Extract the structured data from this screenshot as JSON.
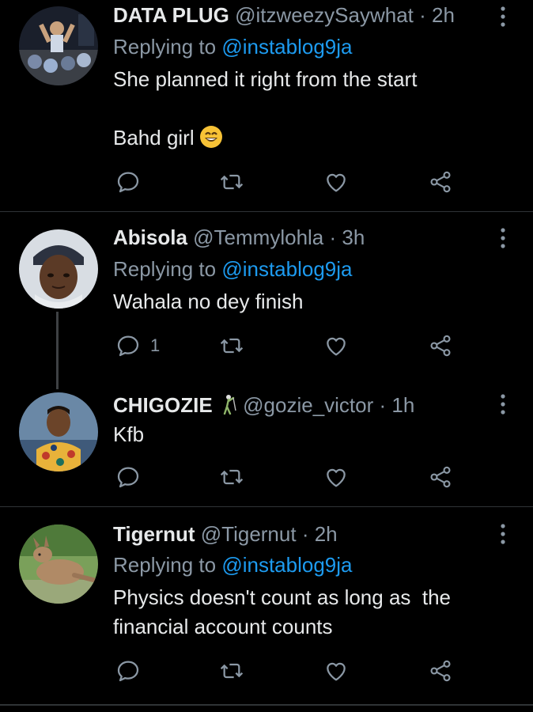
{
  "tweets": [
    {
      "name": "DATA PLUG",
      "handle": "@itzweezySaywhat",
      "time": "2h",
      "reply_prefix": "Replying to ",
      "reply_to": "@instablog9ja",
      "text": "She planned it right from the start\n\nBahd girl",
      "reply_count": ""
    },
    {
      "name": "Abisola",
      "handle": "@Temmylohla",
      "time": "3h",
      "reply_prefix": "Replying to ",
      "reply_to": "@instablog9ja",
      "text": "Wahala no dey finish",
      "reply_count": "1"
    },
    {
      "name": "CHIGOZIE",
      "handle": "@gozie_victor",
      "time": "1h",
      "text": "Kfb",
      "reply_count": ""
    },
    {
      "name": "Tigernut",
      "handle": "@Tigernut",
      "time": "2h",
      "reply_prefix": "Replying to ",
      "reply_to": "@instablog9ja",
      "text": "Physics doesn't count as long as  the financial account counts",
      "reply_count": ""
    }
  ],
  "separator": "·",
  "colors": {
    "background": "#000000",
    "text": "#e7e9ea",
    "muted": "#8b98a5",
    "link": "#1d9bf0",
    "divider": "#2f3336"
  },
  "icons": [
    "reply-icon",
    "retweet-icon",
    "like-icon",
    "share-icon",
    "more-icon",
    "grinning-emoji",
    "golfer-emoji"
  ]
}
